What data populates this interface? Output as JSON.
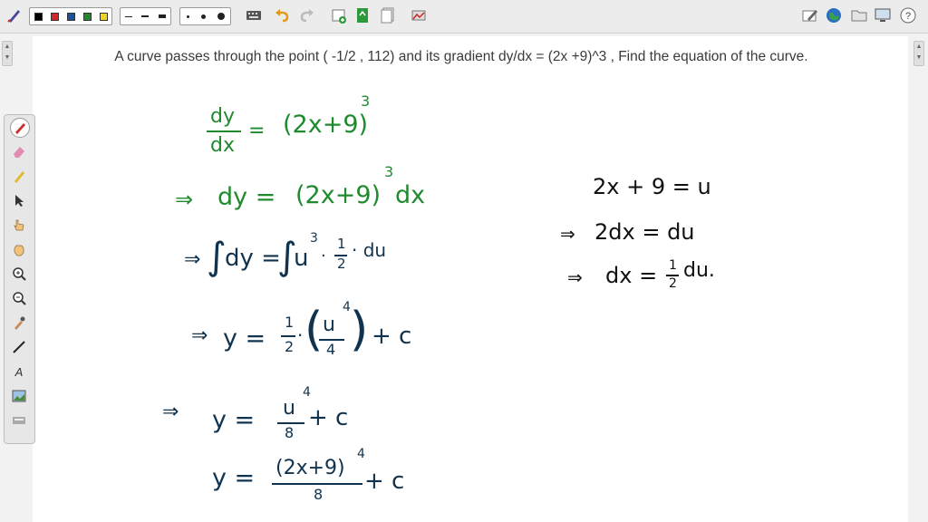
{
  "toolbar": {
    "icons": [
      "pen-tool-icon",
      "color-black",
      "color-red",
      "color-navy",
      "color-green",
      "color-yellow",
      "line-style-long",
      "line-style-medium",
      "line-style-thick",
      "dot-small",
      "dot-medium",
      "dot-large",
      "keyboard-icon",
      "undo-icon",
      "redo-icon",
      "add-page-icon",
      "export-icon",
      "pages-icon",
      "screenshot-icon",
      "edit-icon",
      "globe-icon",
      "folder-icon",
      "monitor-icon",
      "help-icon"
    ],
    "colors": [
      "#000000",
      "#d9232a",
      "#1e4f9c",
      "#1f8a2e",
      "#f3d21b"
    ]
  },
  "question": "A curve passes through the point ( -1/2 , 112) and its gradient dy/dx = (2x +9)^3 , Find the equation of the curve.",
  "left_tools": [
    "pen-icon",
    "eraser-icon",
    "highlighter-icon",
    "pointer-icon",
    "hand-pointer-icon",
    "hand-grab-icon",
    "zoom-in-icon",
    "zoom-out-icon",
    "eyedropper-icon",
    "line-icon",
    "text-icon",
    "image-icon",
    "keyboard-icon"
  ],
  "tool_text": "A",
  "work": {
    "line1": {
      "num": "dy",
      "den": "dx",
      "eq": "=",
      "rhs": "(2x+9)",
      "exp": "3"
    },
    "line2": {
      "arrow": "⇒",
      "lhs": "dy =",
      "rhs": "(2x+9)",
      "exp": "3",
      "tail": "dx"
    },
    "line3": {
      "arrow": "⇒",
      "int1": "∫",
      "lhs": "dy =",
      "int2": "∫",
      "u": "u",
      "exp": "3",
      "dot": "·",
      "half_num": "1",
      "half_den": "2",
      "tail": "· du"
    },
    "line4": {
      "arrow": "⇒",
      "lhs": "y =",
      "half_num": "1",
      "half_den": "2",
      "dot": "·",
      "lparen": "(",
      "u_num": "u",
      "exp": "4",
      "u_den": "4",
      "rparen": ")",
      "tail": "+ c"
    },
    "line5": {
      "arrow": "⇒",
      "lhs": "y =",
      "num": "u",
      "exp": "4",
      "den": "8",
      "tail": "+ c"
    },
    "line6": {
      "lhs": "y =",
      "num": "(2x+9)",
      "exp": "4",
      "den": "8",
      "tail": "+ c"
    }
  },
  "side": {
    "s1": "2x + 9 = u",
    "s2": {
      "arrow": "⇒",
      "text": "2dx = du"
    },
    "s3": {
      "arrow": "⇒",
      "lhs": "dx =",
      "num": "1",
      "den": "2",
      "tail": "du."
    }
  }
}
